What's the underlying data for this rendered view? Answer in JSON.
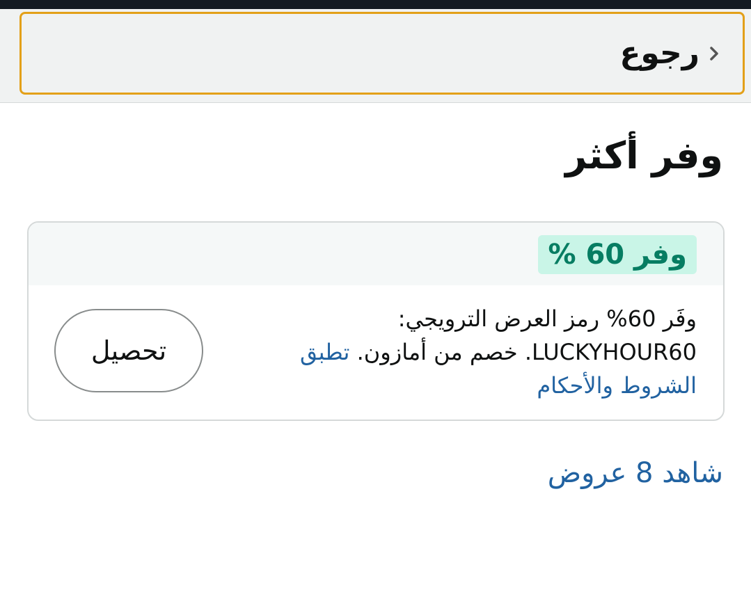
{
  "header": {
    "back_label": "رجوع"
  },
  "page": {
    "title": "وفر أكثر"
  },
  "offer": {
    "badge": "وفر 60 %",
    "description": "وفَر 60% رمز العرض الترويجي: LUCKYHOUR60. خصم من أمازون.",
    "terms_link": "تطبق الشروط والأحكام",
    "claim_label": "تحصيل"
  },
  "footer": {
    "see_offers_link": "شاهد 8 عروض"
  },
  "colors": {
    "accent_border": "#e3a019",
    "badge_bg": "#c9f5e7",
    "badge_text": "#067d62",
    "link": "#2162a1"
  }
}
